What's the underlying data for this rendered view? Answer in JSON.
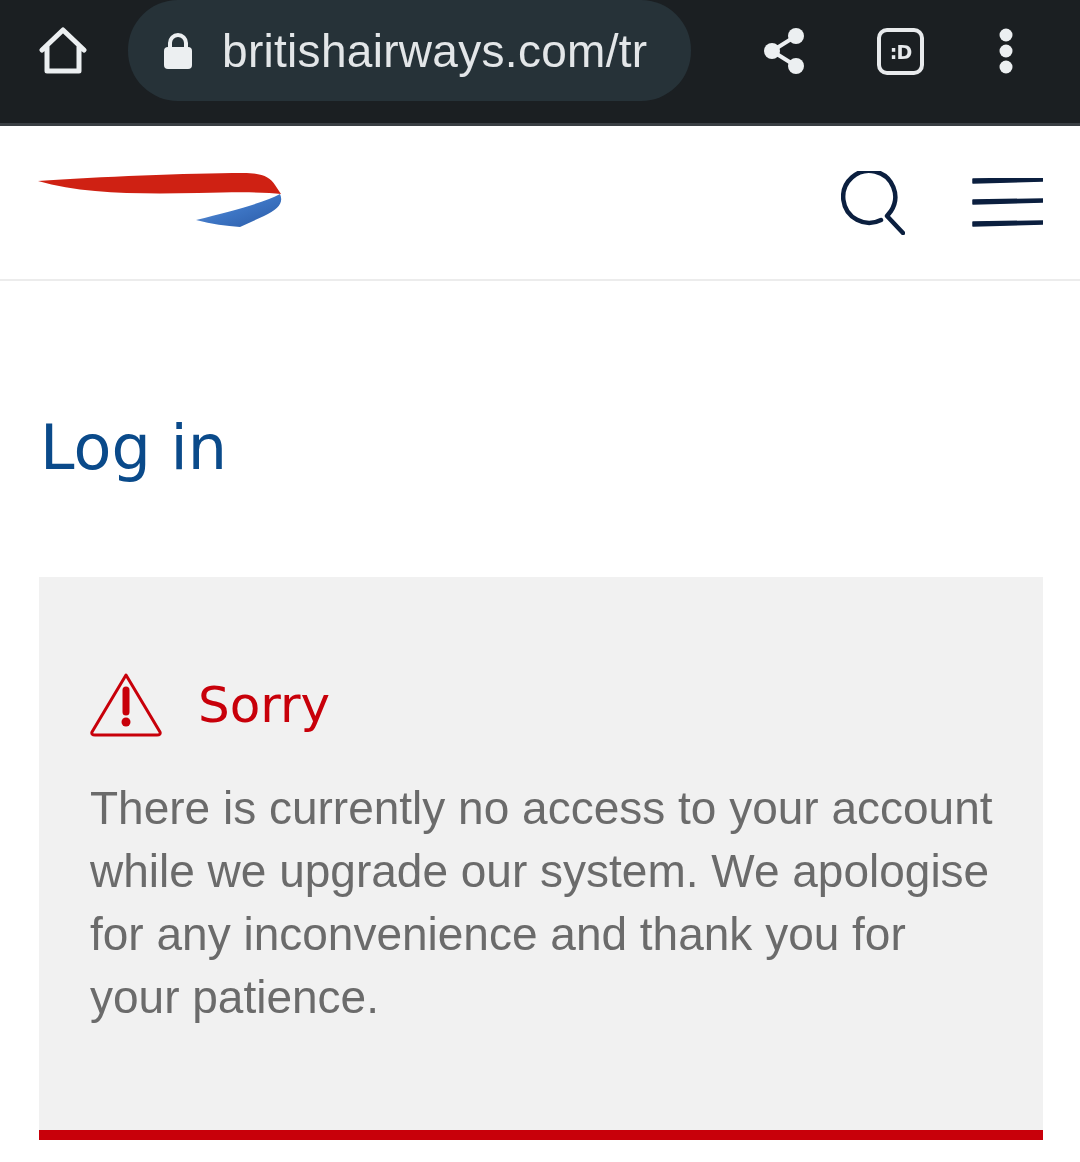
{
  "browser_bar": {
    "url": "britishairways.com/tr",
    "tabs_button": ":D"
  },
  "page": {
    "title": "Log in"
  },
  "alert": {
    "title": "Sorry",
    "message": "There is currently no access to your account while we upgrade our system. We apologise for any inconvenience and thank you for your patience."
  }
}
